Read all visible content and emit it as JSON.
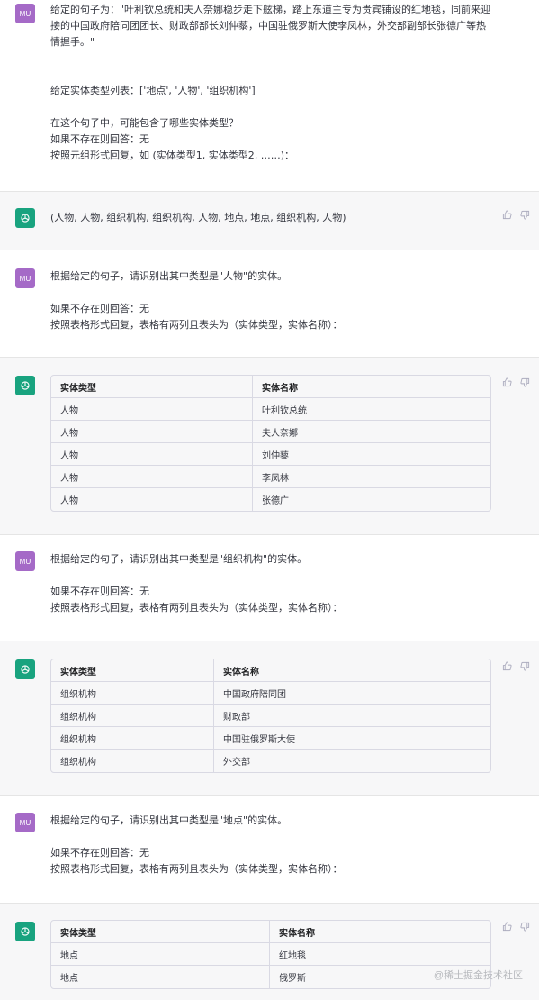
{
  "user_avatar_label": "MU",
  "messages": {
    "q1": "给定的句子为：\"叶利钦总统和夫人奈娜稳步走下舷梯，踏上东道主专为贵宾铺设的红地毯，同前来迎接的中国政府陪同团团长、财政部部长刘仲藜，中国驻俄罗斯大使李凤林，外交部副部长张德广等热情握手。\"\n\n\n给定实体类型列表：['地点', '人物', '组织机构']\n\n在这个句子中，可能包含了哪些实体类型？\n如果不存在则回答：无\n按照元组形式回复，如 (实体类型1, 实体类型2, ……)：",
    "a1": "(人物, 人物, 组织机构, 组织机构, 人物, 地点, 地点, 组织机构, 人物)",
    "q2": "根据给定的句子，请识别出其中类型是\"人物\"的实体。\n\n如果不存在则回答：无\n按照表格形式回复，表格有两列且表头为（实体类型，实体名称）：",
    "q3": "根据给定的句子，请识别出其中类型是\"组织机构\"的实体。\n\n如果不存在则回答：无\n按照表格形式回复，表格有两列且表头为（实体类型，实体名称）：",
    "q4": "根据给定的句子，请识别出其中类型是\"地点\"的实体。\n\n如果不存在则回答：无\n按照表格形式回复，表格有两列且表头为（实体类型，实体名称）："
  },
  "tables": {
    "t1": {
      "headers": [
        "实体类型",
        "实体名称"
      ],
      "rows": [
        [
          "人物",
          "叶利钦总统"
        ],
        [
          "人物",
          "夫人奈娜"
        ],
        [
          "人物",
          "刘仲藜"
        ],
        [
          "人物",
          "李凤林"
        ],
        [
          "人物",
          "张德广"
        ]
      ]
    },
    "t2": {
      "headers": [
        "实体类型",
        "实体名称"
      ],
      "rows": [
        [
          "组织机构",
          "中国政府陪同团"
        ],
        [
          "组织机构",
          "财政部"
        ],
        [
          "组织机构",
          "中国驻俄罗斯大使"
        ],
        [
          "组织机构",
          "外交部"
        ]
      ]
    },
    "t3": {
      "headers": [
        "实体类型",
        "实体名称"
      ],
      "rows": [
        [
          "地点",
          "红地毯"
        ],
        [
          "地点",
          "俄罗斯"
        ]
      ]
    }
  },
  "watermark": "@稀土掘金技术社区",
  "colors": {
    "user_avatar": "#a56ac7",
    "bot_avatar": "#19a37f",
    "bot_bg": "#f7f7f8"
  },
  "icons": {
    "feedback": [
      "thumbs-up-icon",
      "thumbs-down-icon"
    ],
    "bot": "openai-logo-icon"
  }
}
